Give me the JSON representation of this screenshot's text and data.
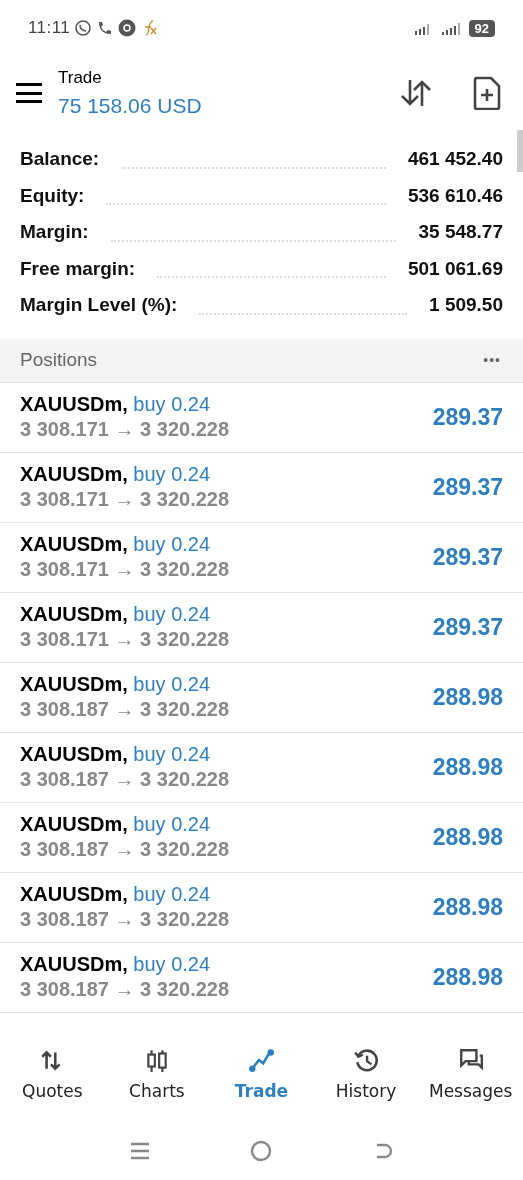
{
  "status_bar": {
    "time": "11:11",
    "battery": "92"
  },
  "header": {
    "title": "Trade",
    "amount": "75 158.06 USD"
  },
  "summary": [
    {
      "label": "Balance:",
      "value": "461 452.40"
    },
    {
      "label": "Equity:",
      "value": "536 610.46"
    },
    {
      "label": "Margin:",
      "value": "35 548.77"
    },
    {
      "label": "Free margin:",
      "value": "501 061.69"
    },
    {
      "label": "Margin Level (%):",
      "value": "1 509.50"
    }
  ],
  "positions": {
    "title": "Positions",
    "more": "•••",
    "rows": [
      {
        "symbol": "XAUUSDm,",
        "side": "buy 0.24",
        "prices": "3 308.171 → 3 320.228",
        "profit": "289.37"
      },
      {
        "symbol": "XAUUSDm,",
        "side": "buy 0.24",
        "prices": "3 308.171 → 3 320.228",
        "profit": "289.37"
      },
      {
        "symbol": "XAUUSDm,",
        "side": "buy 0.24",
        "prices": "3 308.171 → 3 320.228",
        "profit": "289.37"
      },
      {
        "symbol": "XAUUSDm,",
        "side": "buy 0.24",
        "prices": "3 308.171 → 3 320.228",
        "profit": "289.37"
      },
      {
        "symbol": "XAUUSDm,",
        "side": "buy 0.24",
        "prices": "3 308.187 → 3 320.228",
        "profit": "288.98"
      },
      {
        "symbol": "XAUUSDm,",
        "side": "buy 0.24",
        "prices": "3 308.187 → 3 320.228",
        "profit": "288.98"
      },
      {
        "symbol": "XAUUSDm,",
        "side": "buy 0.24",
        "prices": "3 308.187 → 3 320.228",
        "profit": "288.98"
      },
      {
        "symbol": "XAUUSDm,",
        "side": "buy 0.24",
        "prices": "3 308.187 → 3 320.228",
        "profit": "288.98"
      },
      {
        "symbol": "XAUUSDm,",
        "side": "buy 0.24",
        "prices": "3 308.187 → 3 320.228",
        "profit": "288.98"
      }
    ]
  },
  "bottom_nav": [
    {
      "label": "Quotes",
      "selected": false,
      "kind": "quotes"
    },
    {
      "label": "Charts",
      "selected": false,
      "kind": "charts"
    },
    {
      "label": "Trade",
      "selected": true,
      "kind": "trade"
    },
    {
      "label": "History",
      "selected": false,
      "kind": "history"
    },
    {
      "label": "Messages",
      "selected": false,
      "kind": "messages"
    }
  ]
}
